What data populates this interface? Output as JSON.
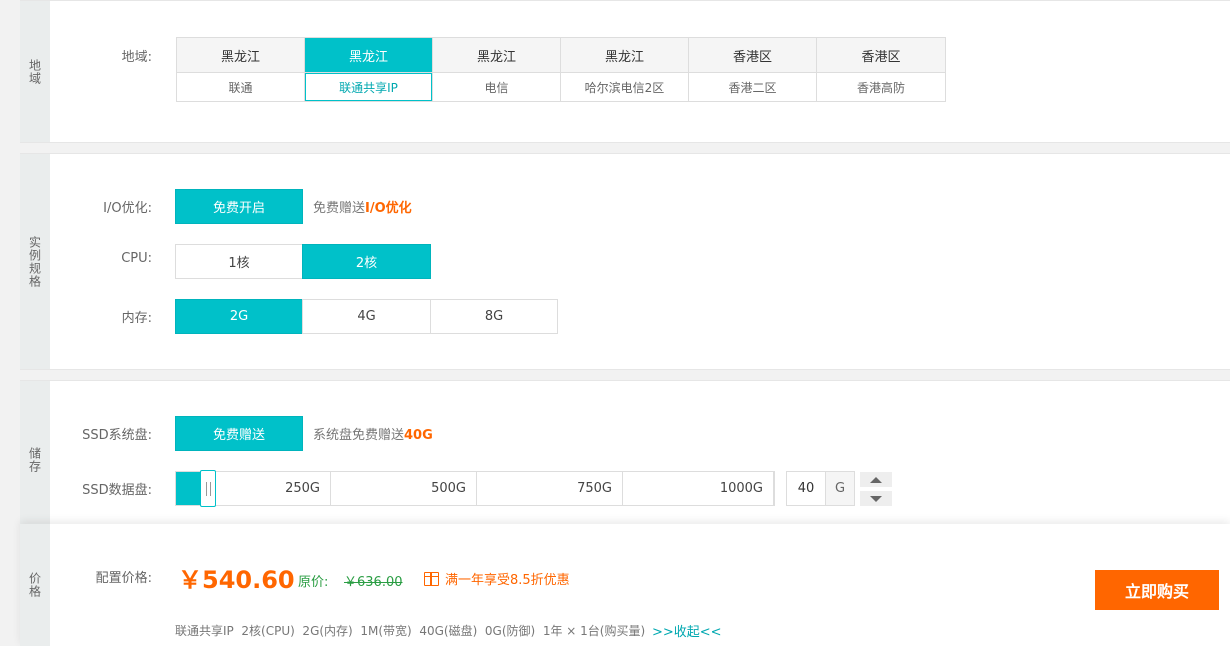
{
  "region": {
    "side_label": "地域",
    "label": "地域:",
    "items": [
      {
        "province": "黑龙江",
        "line": "联通"
      },
      {
        "province": "黑龙江",
        "line": "联通共享IP"
      },
      {
        "province": "黑龙江",
        "line": "电信"
      },
      {
        "province": "黑龙江",
        "line": "哈尔滨电信2区"
      },
      {
        "province": "香港区",
        "line": "香港二区"
      },
      {
        "province": "香港区",
        "line": "香港高防"
      }
    ],
    "selected_index": 1
  },
  "spec": {
    "side_label": "实例规格",
    "io": {
      "label": "I/O优化:",
      "button": "免费开启",
      "note_prefix": "免费赠送",
      "note_highlight": "I/O优化"
    },
    "cpu": {
      "label": "CPU:",
      "options": [
        "1核",
        "2核"
      ],
      "selected": "2核"
    },
    "memory": {
      "label": "内存:",
      "options": [
        "2G",
        "4G",
        "8G"
      ],
      "selected": "2G"
    }
  },
  "storage": {
    "side_label": "储存",
    "system_disk": {
      "label": "SSD系统盘:",
      "button": "免费赠送",
      "note_prefix": "系统盘免费赠送",
      "note_highlight": "40G"
    },
    "data_disk": {
      "label": "SSD数据盘:",
      "ticks": [
        "250G",
        "500G",
        "750G",
        "1000G"
      ],
      "value": "40",
      "unit": "G",
      "level_fraction": 0.04
    }
  },
  "pricing": {
    "side_label": "价格",
    "label": "配置价格:",
    "price": "￥540.60",
    "original_label": "原价:",
    "original_price": "￥636.00",
    "promo": "满一年享受8.5折优惠",
    "summary": "联通共享IP  2核(CPU)  2G(内存)  1M(带宽)  40G(磁盘)  0G(防御)  1年 × 1台(购买量)",
    "collapse": ">>收起<<",
    "buy_button": "立即购买"
  },
  "colors": {
    "accent": "#00c1c9",
    "orange": "#ff6600",
    "green": "#2a9d43"
  }
}
